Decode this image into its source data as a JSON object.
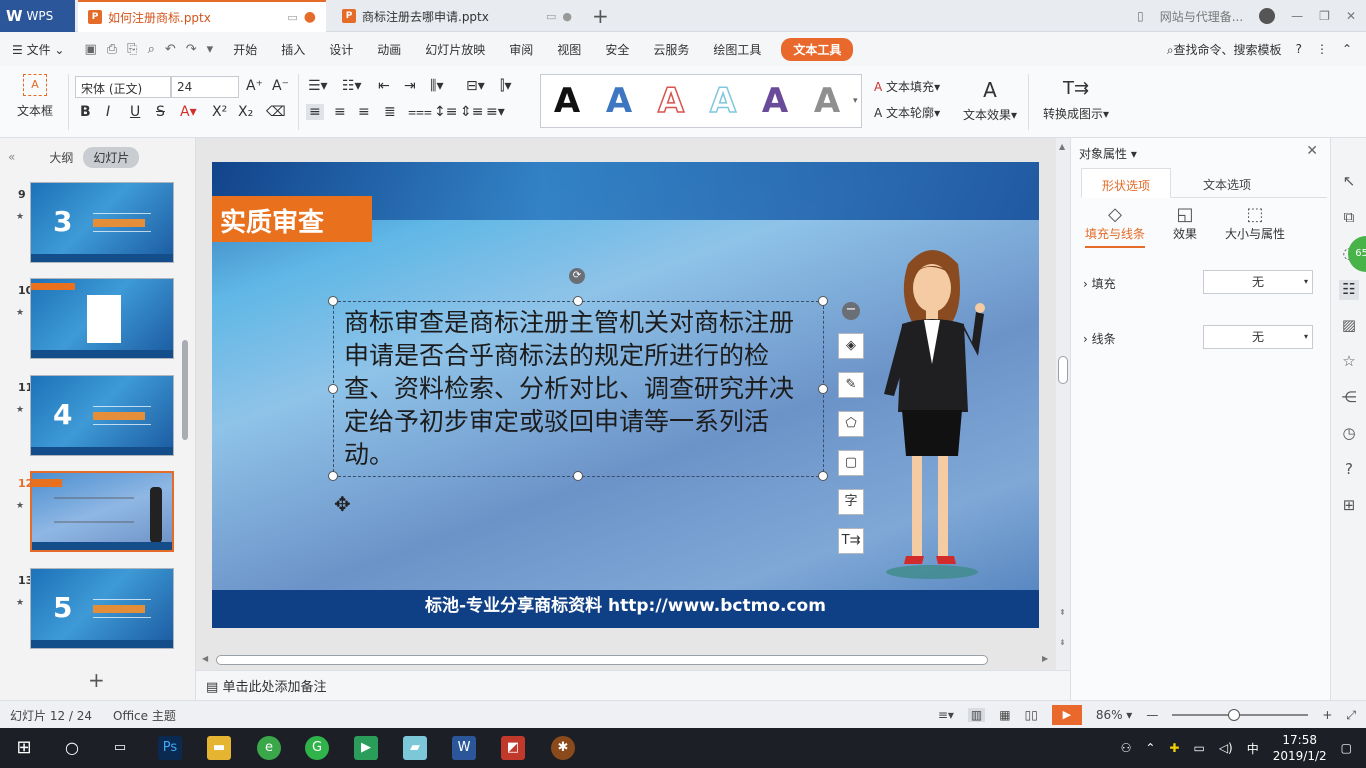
{
  "tabs": {
    "app": "WPS",
    "doc1": "如何注册商标.pptx",
    "doc2": "商标注册去哪申请.pptx",
    "right_text": "网站与代理备..."
  },
  "menu": {
    "file": "文件",
    "items": [
      "开始",
      "插入",
      "设计",
      "动画",
      "幻灯片放映",
      "审阅",
      "视图",
      "安全",
      "云服务",
      "绘图工具"
    ],
    "highlight": "文本工具",
    "search": "查找命令、搜索模板"
  },
  "ribbon": {
    "textbox_label": "文本框",
    "font_name": "宋体 (正文)",
    "font_size": "24",
    "text_fill": "文本填充",
    "text_outline": "文本轮廓",
    "text_effect": "文本效果",
    "convert": "转换成图示",
    "style_colors": [
      "#111111",
      "#3f76c2",
      "#d9534f",
      "#7fc7df",
      "#6a4b9a",
      "#8f8f8f"
    ]
  },
  "left_panel": {
    "tab_outline": "大纲",
    "tab_slides": "幻灯片",
    "thumbs": [
      {
        "num": "9",
        "big": "3"
      },
      {
        "num": "10",
        "big": ""
      },
      {
        "num": "11",
        "big": "4"
      },
      {
        "num": "12",
        "big": ""
      },
      {
        "num": "13",
        "big": "5"
      }
    ]
  },
  "slide": {
    "title": "实质审查",
    "body": "商标审查是商标注册主管机关对商标注册申请是否合乎商标法的规定所进行的检查、资料检索、分析对比、调查研究并决定给予初步审定或驳回申请等一系列活动。",
    "footer": "标池-专业分享商标资料 http://www.bctmo.com"
  },
  "notes": "单击此处添加备注",
  "right_panel": {
    "title": "对象属性",
    "tab_shape": "形状选项",
    "tab_text": "文本选项",
    "sub_fill": "填充与线条",
    "sub_effect": "效果",
    "sub_size": "大小与属性",
    "fill_label": "填充",
    "fill_value": "无",
    "line_label": "线条",
    "line_value": "无",
    "badge": "65"
  },
  "status": {
    "slide_pos": "幻灯片 12 / 24",
    "theme": "Office 主题",
    "zoom": "86%"
  },
  "taskbar": {
    "time": "17:58",
    "date": "2019/1/2",
    "ime": "中"
  }
}
